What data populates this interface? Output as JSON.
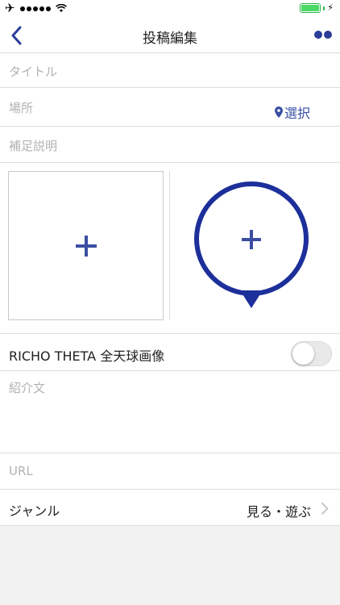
{
  "status_bar": {
    "airplane_icon": "airplane-icon",
    "wifi_icon": "wifi-icon",
    "battery_icon": "battery-icon",
    "charging_icon": "charging-bolt-icon"
  },
  "navbar": {
    "title": "投稿編集",
    "back_icon": "chevron-left-icon",
    "more_icon": "more-dots-icon"
  },
  "form": {
    "title_placeholder": "タイトル",
    "place_label": "場所",
    "place_select": "選択",
    "supplement_placeholder": "補足説明",
    "richo_label": "RICHO THETA 全天球画像",
    "richo_enabled": false,
    "intro_placeholder": "紹介文",
    "url_placeholder": "URL",
    "genre_label": "ジャンル",
    "genre_value": "見る・遊ぶ"
  },
  "colors": {
    "accent": "#2b3d98",
    "pin_blue": "#1d2f9a",
    "placeholder": "#b2b2b2",
    "background": "#f2f2f2"
  }
}
